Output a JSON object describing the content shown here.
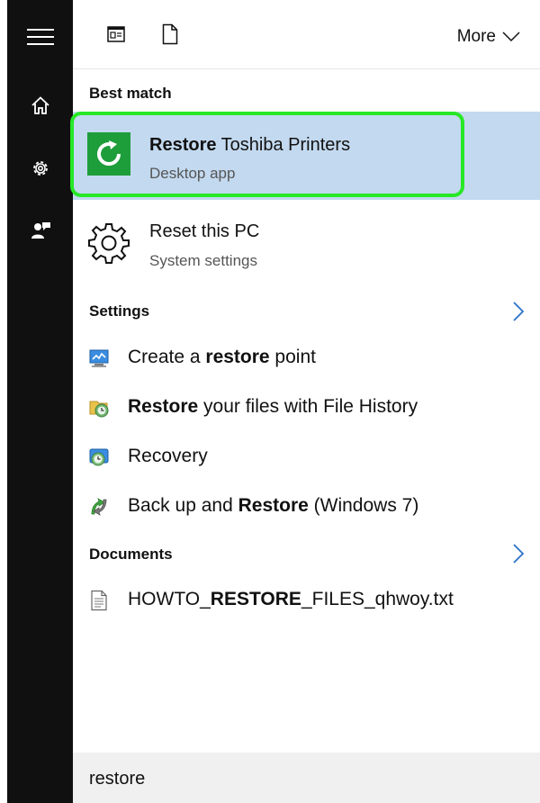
{
  "toolbar": {
    "more_label": "More"
  },
  "best_match": {
    "heading": "Best match",
    "top": {
      "title_bold": "Restore",
      "title_rest": " Toshiba Printers",
      "subtitle": "Desktop app"
    },
    "second": {
      "title": "Reset this PC",
      "subtitle": "System settings"
    }
  },
  "settings": {
    "heading": "Settings",
    "items": [
      {
        "pre": "Create a ",
        "bold": "restore",
        "post": " point",
        "icon": "system-restore-icon"
      },
      {
        "pre": "",
        "bold": "Restore",
        "post": " your files with File History",
        "icon": "file-history-icon"
      },
      {
        "pre": "Recovery",
        "bold": "",
        "post": "",
        "icon": "recovery-icon"
      },
      {
        "pre": "Back up and ",
        "bold": "Restore",
        "post": " (Windows 7)",
        "icon": "backup-restore-icon"
      }
    ]
  },
  "documents": {
    "heading": "Documents",
    "items": [
      {
        "pre": "HOWTO_",
        "bold": "RESTORE",
        "post": "_FILES_qhwoy.txt",
        "icon": "text-file-icon"
      }
    ]
  },
  "search": {
    "query": "restore"
  },
  "colors": {
    "rail": "#101010",
    "highlight": "#c3d9ef",
    "outline": "#27e827",
    "app_tile": "#1e9d3b"
  }
}
